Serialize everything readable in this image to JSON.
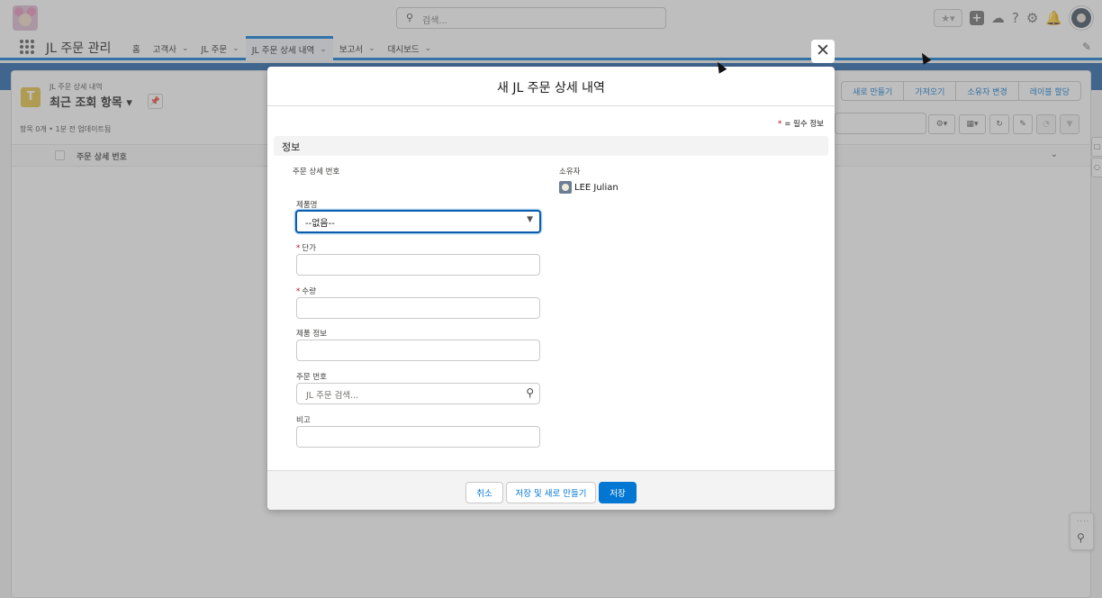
{
  "topbar": {
    "search_placeholder": "검색...",
    "icons": [
      "favorites-star-icon",
      "add-icon",
      "cloud-icon",
      "help-icon",
      "setup-gear-icon",
      "notification-bell-icon",
      "user-avatar"
    ]
  },
  "navbar": {
    "app_name": "JL 주문 관리",
    "items": [
      {
        "label": "홈",
        "has_menu": false,
        "active": false
      },
      {
        "label": "고객사",
        "has_menu": true,
        "active": false
      },
      {
        "label": "JL 주문",
        "has_menu": true,
        "active": false
      },
      {
        "label": "JL 주문 상세 내역",
        "has_menu": true,
        "active": true
      },
      {
        "label": "보고서",
        "has_menu": true,
        "active": false
      },
      {
        "label": "대시보드",
        "has_menu": true,
        "active": false
      }
    ]
  },
  "list_view": {
    "object_label": "JL 주문 상세 내역",
    "view_title": "최근 조회 항목",
    "meta": "항목 0개 • 1분 전 업데이트됨",
    "buttons": [
      "새로 만들기",
      "가져오기",
      "소유자 변경",
      "레이블 할당"
    ],
    "column_header": "주문 상세 번호"
  },
  "modal": {
    "title": "새 JL 주문 상세 내역",
    "required_note": "= 필수 정보",
    "section_title": "정보",
    "fields": {
      "order_detail_number": {
        "label": "주문 상세 번호"
      },
      "owner": {
        "label": "소유자",
        "value": "LEE Julian"
      },
      "product_name": {
        "label": "제품명",
        "value": "--없음--"
      },
      "unit_price": {
        "label": "단가",
        "required": true,
        "value": ""
      },
      "quantity": {
        "label": "수량",
        "required": true,
        "value": ""
      },
      "product_info": {
        "label": "제품 정보",
        "value": ""
      },
      "order_number": {
        "label": "주문 번호",
        "placeholder": "JL 주문 검색...",
        "value": ""
      },
      "remarks": {
        "label": "비고",
        "value": ""
      }
    },
    "footer": {
      "cancel": "취소",
      "save_and_new": "저장 및 새로 만들기",
      "save": "저장"
    }
  },
  "colors": {
    "brand": "#0176d3",
    "required": "#ba0517",
    "banner": "#1b5fa8"
  }
}
